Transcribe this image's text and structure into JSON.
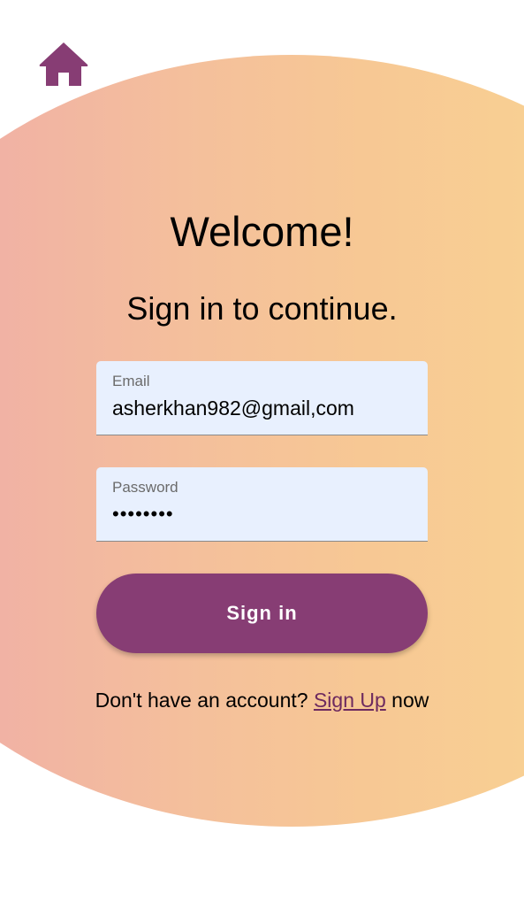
{
  "colors": {
    "accent": "#873d74",
    "gradient_start": "#f1b2a4",
    "gradient_end": "#f8cf93",
    "field_background": "#e8f0fe",
    "link": "#6d2a5f"
  },
  "header": {
    "home_icon": "home-icon"
  },
  "main": {
    "title": "Welcome!",
    "subtitle": "Sign in to continue."
  },
  "form": {
    "email": {
      "label": "Email",
      "value": "asherkhan982@gmail,com"
    },
    "password": {
      "label": "Password",
      "value": "••••••••"
    },
    "submit_label": "Sign in"
  },
  "footer": {
    "prompt": "Don't have an account? ",
    "link_label": "Sign Up",
    "suffix": " now"
  }
}
